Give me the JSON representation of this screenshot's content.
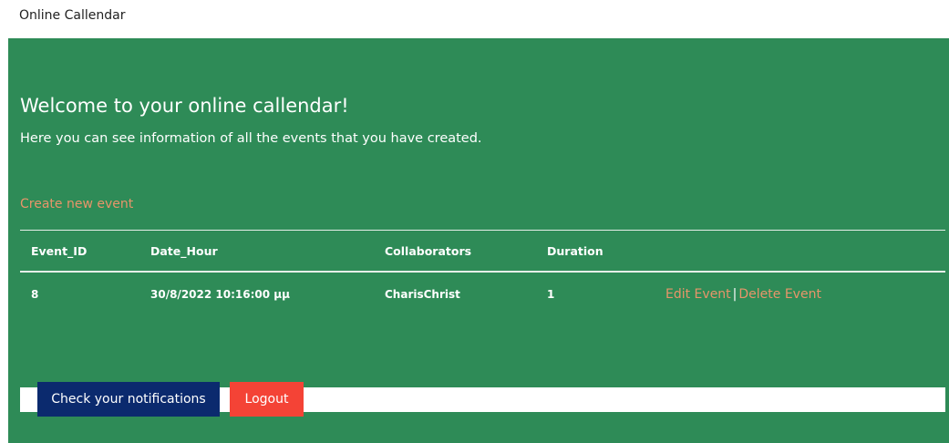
{
  "header": {
    "app_title": "Online Callendar"
  },
  "main": {
    "welcome_title": "Welcome to your online callendar!",
    "welcome_subtitle": "Here you can see information of all the events that you have created.",
    "create_link": "Create new event",
    "table": {
      "columns": [
        "Event_ID",
        "Date_Hour",
        "Collaborators",
        "Duration",
        ""
      ],
      "rows": [
        {
          "event_id": "8",
          "date_hour": "30/8/2022 10:16:00 μμ",
          "collaborators": "CharisChrist",
          "duration": "1",
          "edit_label": "Edit Event",
          "separator": "|",
          "delete_label": "Delete Event"
        }
      ]
    }
  },
  "footer": {
    "notifications_label": "Check your notifications",
    "logout_label": "Logout"
  },
  "colors": {
    "panel_green": "#2e8b57",
    "link_orange": "#e8956a",
    "notif_navy": "#0b2a6e",
    "logout_red": "#f44336"
  }
}
